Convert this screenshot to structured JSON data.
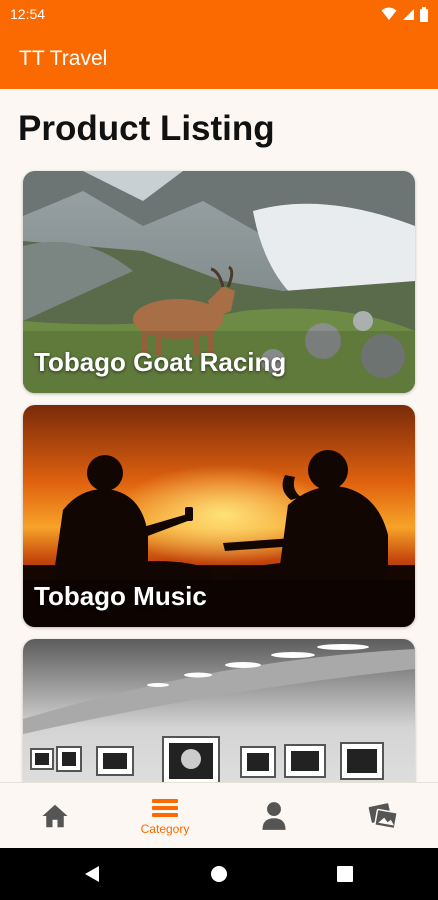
{
  "status_bar": {
    "time": "12:54",
    "icons": [
      "wifi-icon",
      "signal-icon",
      "battery-icon"
    ]
  },
  "app_bar": {
    "title": "TT Travel"
  },
  "page": {
    "title": "Product Listing"
  },
  "cards": [
    {
      "label": "Tobago Goat Racing",
      "image": "mountain-goat-photo"
    },
    {
      "label": "Tobago Music",
      "image": "guitarists-sunset-photo"
    },
    {
      "label": "",
      "image": "art-gallery-photo"
    }
  ],
  "bottom_nav": {
    "items": [
      {
        "icon": "home-icon",
        "label": ""
      },
      {
        "icon": "category-icon",
        "label": "Category",
        "active": true
      },
      {
        "icon": "person-icon",
        "label": ""
      },
      {
        "icon": "photos-icon",
        "label": ""
      }
    ]
  },
  "colors": {
    "primary": "#fb6a00",
    "background": "#fcf7f2",
    "nav_inactive": "#555555"
  }
}
